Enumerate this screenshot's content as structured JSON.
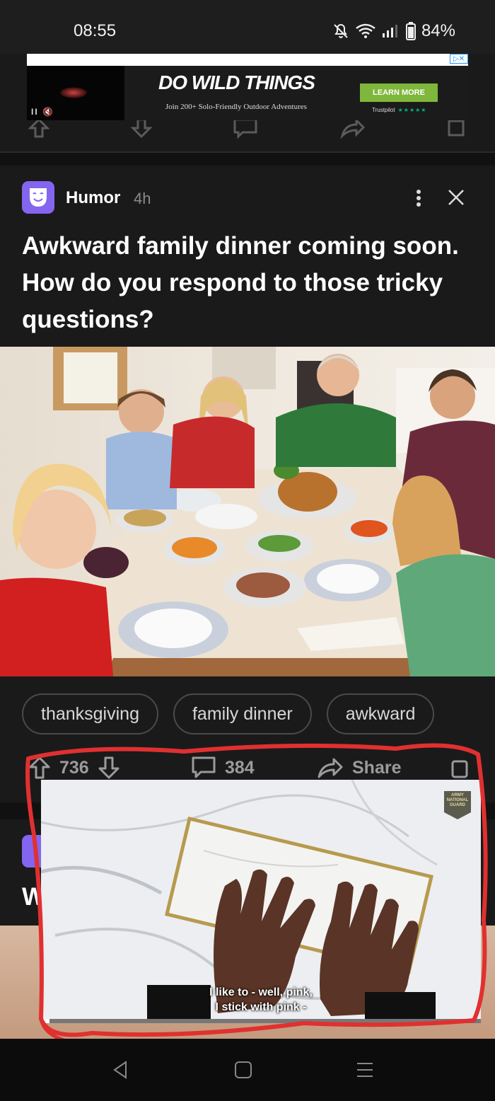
{
  "status_bar": {
    "time": "08:55",
    "battery": "84%",
    "icons": [
      "mute-icon",
      "wifi-icon",
      "signal-icon",
      "battery-icon"
    ]
  },
  "ad": {
    "headline": "DO WILD THINGS",
    "subline": "Join 200+ Solo-Friendly Outdoor Adventures",
    "cta": "LEARN MORE",
    "trust": "Trustpilot",
    "trust_stars": "★★★★★",
    "adchoices": "▷✕",
    "video_controls": "II 🔇"
  },
  "previous_post": {
    "icons": [
      "upvote-icon",
      "downvote-icon",
      "comment-icon",
      "share-icon",
      "save-icon"
    ]
  },
  "post": {
    "section": "Humor",
    "time": "4h",
    "title": "Awkward family dinner coming soon. How do you respond to those tricky questions?",
    "image_alt": "Family sitting at a Thanksgiving dinner table",
    "tags": [
      "thanksgiving",
      "family dinner",
      "awkward"
    ],
    "upvotes": "736",
    "comments": "384",
    "share_label": "Share"
  },
  "next_post": {
    "title_initial": "W"
  },
  "video": {
    "caption_line1": "I like to - well, pink,",
    "caption_line2": "I stick with pink -",
    "badge_lines": [
      "ARMY",
      "NATIONAL",
      "GUARD"
    ],
    "progress": 0.02
  },
  "colors": {
    "accent_purple": "#8465f0",
    "ad_cta_green": "#7fb63c",
    "scribble_red": "#e03030",
    "card_bg": "#1a1a1a"
  }
}
